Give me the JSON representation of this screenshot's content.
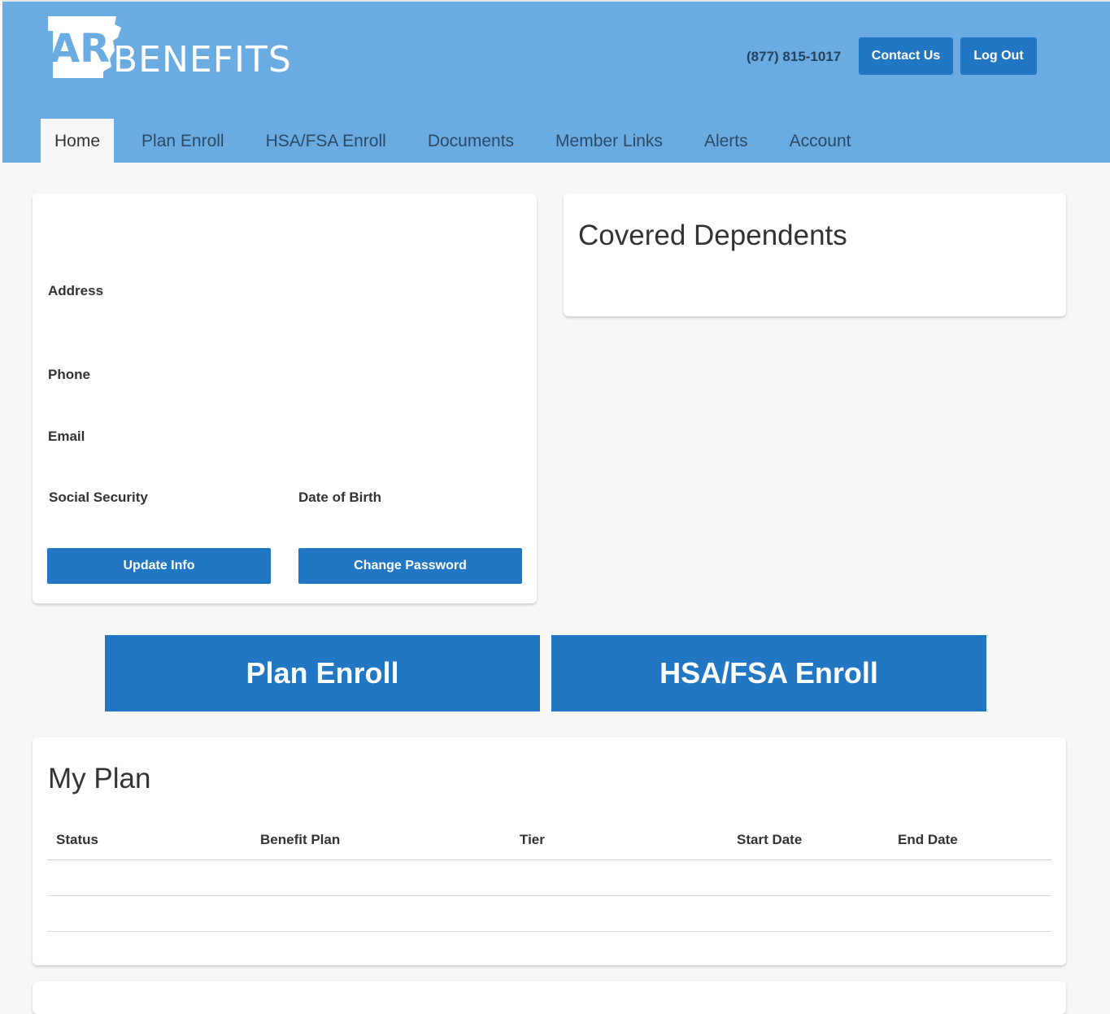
{
  "header": {
    "logo_text": "BENEFITS",
    "logo_mark": "AR",
    "phone": "(877) 815-1017",
    "contact_label": "Contact Us",
    "logout_label": "Log Out"
  },
  "nav": {
    "items": [
      "Home",
      "Plan Enroll",
      "HSA/FSA Enroll",
      "Documents",
      "Member Links",
      "Alerts",
      "Account"
    ],
    "active": "Home"
  },
  "profile": {
    "address_label": "Address",
    "phone_label": "Phone",
    "email_label": "Email",
    "ssn_label": "Social Security",
    "dob_label": "Date of Birth",
    "update_label": "Update Info",
    "password_label": "Change Password"
  },
  "dependents": {
    "title": "Covered Dependents"
  },
  "actions": {
    "plan_enroll": "Plan Enroll",
    "hsa_enroll": "HSA/FSA Enroll"
  },
  "my_plan": {
    "title": "My Plan",
    "columns": [
      "Status",
      "Benefit Plan",
      "Tier",
      "Start Date",
      "End Date"
    ]
  },
  "colors": {
    "header_bg": "#6aabe2",
    "button": "#2277c5",
    "page_bg": "#f7f7f7"
  }
}
